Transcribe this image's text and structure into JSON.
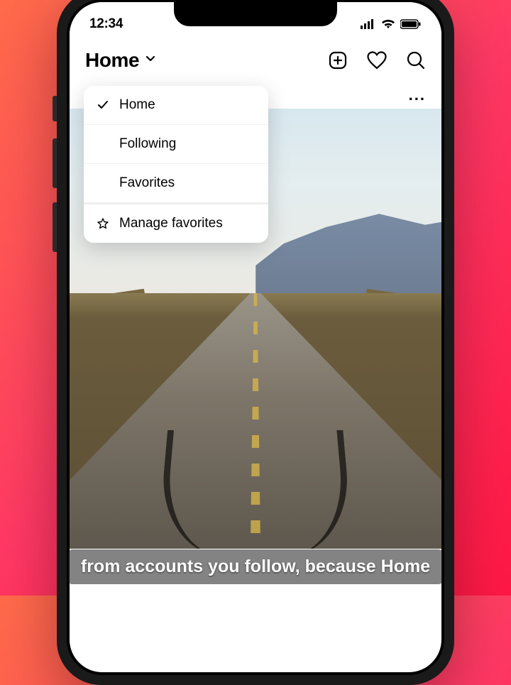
{
  "status_bar": {
    "time": "12:34"
  },
  "header": {
    "title": "Home"
  },
  "dropdown": {
    "items": [
      {
        "label": "Home",
        "selected": true,
        "icon": "check"
      },
      {
        "label": "Following",
        "selected": false,
        "icon": ""
      },
      {
        "label": "Favorites",
        "selected": false,
        "icon": ""
      },
      {
        "label": "Manage favorites",
        "selected": false,
        "icon": "star"
      }
    ]
  },
  "post": {
    "more": "..."
  },
  "caption": {
    "text": "from accounts you follow, because Home"
  }
}
